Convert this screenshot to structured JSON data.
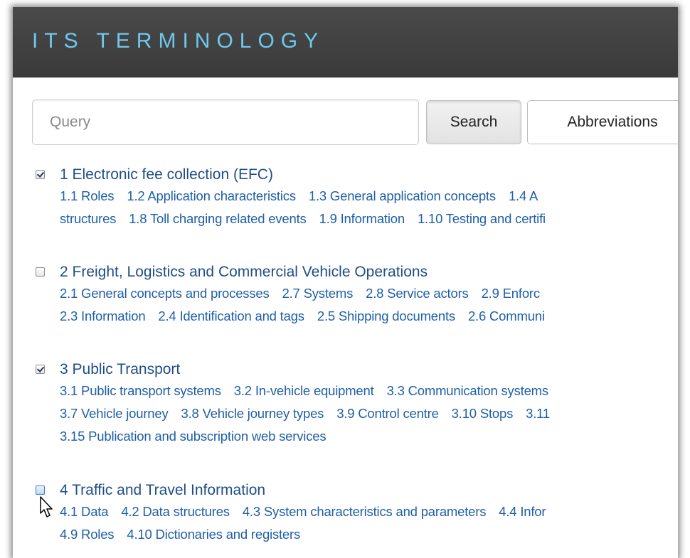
{
  "header": {
    "title": "ITS TERMINOLOGY"
  },
  "search": {
    "placeholder": "Query",
    "search_label": "Search",
    "abbreviations_label": "Abbreviations"
  },
  "categories": [
    {
      "title": "1 Electronic fee collection (EFC)",
      "checked": true,
      "lines": [
        [
          "1.1 Roles",
          "1.2 Application characteristics",
          "1.3 General application concepts",
          "1.4 A"
        ],
        [
          "structures",
          "1.8 Toll charging related events",
          "1.9 Information",
          "1.10 Testing and certifi"
        ]
      ]
    },
    {
      "title": "2 Freight, Logistics and Commercial Vehicle Operations",
      "checked": false,
      "lines": [
        [
          "2.1 General concepts and processes",
          "2.7 Systems",
          "2.8 Service actors",
          "2.9 Enforc"
        ],
        [
          "2.3 Information",
          "2.4 Identification and tags",
          "2.5 Shipping documents",
          "2.6 Communi"
        ]
      ]
    },
    {
      "title": "3 Public Transport",
      "checked": true,
      "lines": [
        [
          "3.1 Public transport systems",
          "3.2 In-vehicle equipment",
          "3.3 Communication systems"
        ],
        [
          "3.7 Vehicle journey",
          "3.8 Vehicle journey types",
          "3.9 Control centre",
          "3.10 Stops",
          "3.11"
        ],
        [
          "3.15 Publication and subscription web services"
        ]
      ]
    },
    {
      "title": "4 Traffic and Travel Information",
      "checked": false,
      "lines": [
        [
          "4.1 Data",
          "4.2 Data structures",
          "4.3 System characteristics and parameters",
          "4.4 Infor"
        ],
        [
          "4.9 Roles",
          "4.10 Dictionaries and registers"
        ]
      ]
    }
  ]
}
